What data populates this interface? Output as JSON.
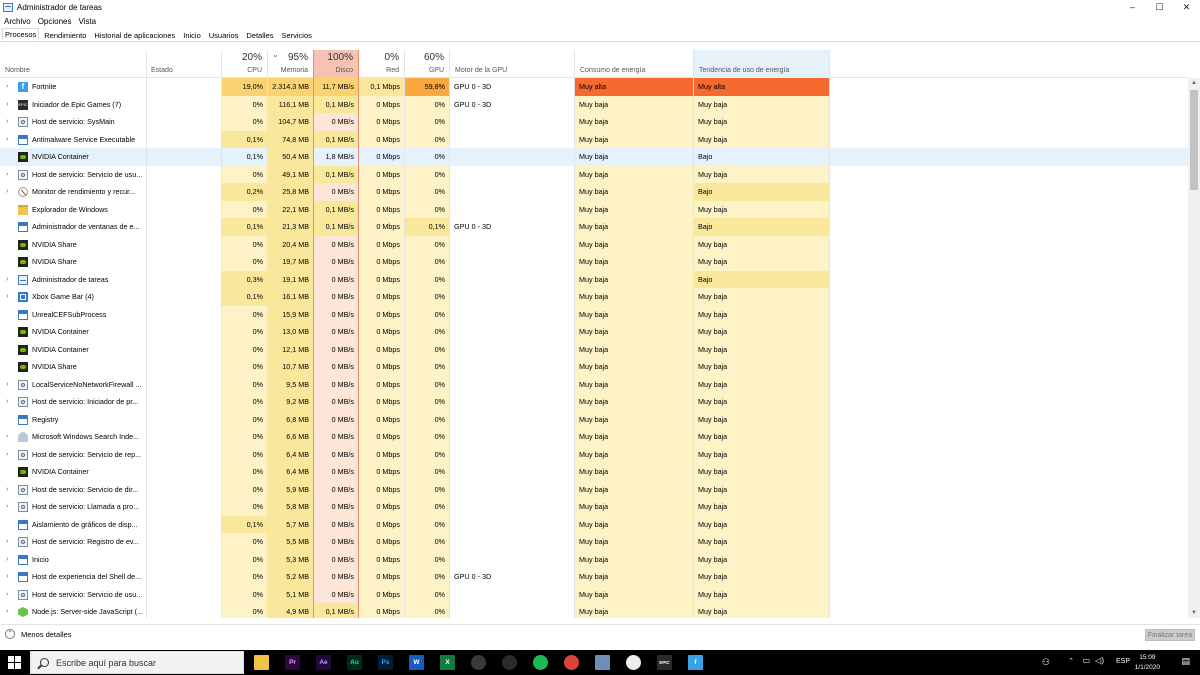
{
  "window": {
    "title": "Administrador de tareas",
    "controls": [
      "–",
      "☐",
      "✕"
    ]
  },
  "menu": [
    "Archivo",
    "Opciones",
    "Vista"
  ],
  "tabs": [
    "Procesos",
    "Rendimiento",
    "Historial de aplicaciones",
    "Inicio",
    "Usuarios",
    "Detalles",
    "Servicios"
  ],
  "header": {
    "name": "Nombre",
    "status": "Estado",
    "cpu": {
      "pct": "20%",
      "label": "CPU"
    },
    "memory": {
      "pct": "95%",
      "label": "Memoria"
    },
    "disk": {
      "pct": "100%",
      "label": "Disco"
    },
    "net": {
      "pct": "0%",
      "label": "Red"
    },
    "gpu": {
      "pct": "60%",
      "label": "GPU"
    },
    "gpu_engine": "Motor de la GPU",
    "power": "Consumo de energía",
    "power_trend": "Tendencia de uso de energía"
  },
  "colors": {
    "cell_light": "#fdf3c6",
    "cell_mid": "#f9e79b",
    "cell_high": "#fbd272",
    "cell_orange": "#f9a73f",
    "power_high": "#f76a2f",
    "selected": "#e5f1fb"
  },
  "processes": [
    {
      "name": "Fortnite",
      "icon": "fortnite-icon",
      "expand": true,
      "cpu": "19,0%",
      "mem": "2.314,3 MB",
      "disk": "11,7 MB/s",
      "net": "0,1 Mbps",
      "gpu": "59,8%",
      "engine": "GPU 0 - 3D",
      "power": "Muy alta",
      "trend": "Muy alta",
      "hot": true
    },
    {
      "name": "Iniciador de Epic Games (7)",
      "icon": "epic-games-icon",
      "expand": true,
      "cpu": "0%",
      "mem": "116,1 MB",
      "disk": "0,1 MB/s",
      "net": "0 Mbps",
      "gpu": "0%",
      "engine": "GPU 0 - 3D",
      "power": "Muy baja",
      "trend": "Muy baja"
    },
    {
      "name": "Host de servicio: SysMain",
      "icon": "gear-icon",
      "expand": true,
      "cpu": "0%",
      "mem": "104,7 MB",
      "disk": "0 MB/s",
      "net": "0 Mbps",
      "gpu": "0%",
      "engine": "",
      "power": "Muy baja",
      "trend": "Muy baja"
    },
    {
      "name": "Antimalware Service Executable",
      "icon": "window-icon",
      "expand": true,
      "cpu": "0,1%",
      "mem": "74,8 MB",
      "disk": "0,1 MB/s",
      "net": "0 Mbps",
      "gpu": "0%",
      "engine": "",
      "power": "Muy baja",
      "trend": "Muy baja"
    },
    {
      "name": "NVIDIA Container",
      "icon": "nvidia-icon",
      "expand": false,
      "cpu": "0,1%",
      "mem": "50,4 MB",
      "disk": "1,8 MB/s",
      "net": "0 Mbps",
      "gpu": "0%",
      "engine": "",
      "power": "Muy baja",
      "trend": "Bajo",
      "selected": true
    },
    {
      "name": "Host de servicio: Servicio de usu...",
      "icon": "gear-icon",
      "expand": true,
      "cpu": "0%",
      "mem": "49,1 MB",
      "disk": "0,1 MB/s",
      "net": "0 Mbps",
      "gpu": "0%",
      "engine": "",
      "power": "Muy baja",
      "trend": "Muy baja"
    },
    {
      "name": "Monitor de rendimiento y recur...",
      "icon": "monitor-icon",
      "expand": true,
      "cpu": "0,2%",
      "mem": "25,8 MB",
      "disk": "0 MB/s",
      "net": "0 Mbps",
      "gpu": "0%",
      "engine": "",
      "power": "Muy baja",
      "trend": "Bajo"
    },
    {
      "name": "Explorador de Windows",
      "icon": "folder-icon",
      "expand": false,
      "cpu": "0%",
      "mem": "22,1 MB",
      "disk": "0,1 MB/s",
      "net": "0 Mbps",
      "gpu": "0%",
      "engine": "",
      "power": "Muy baja",
      "trend": "Muy baja"
    },
    {
      "name": "Administrador de ventanas de e...",
      "icon": "window-icon",
      "expand": false,
      "cpu": "0,1%",
      "mem": "21,3 MB",
      "disk": "0,1 MB/s",
      "net": "0 Mbps",
      "gpu": "0,1%",
      "engine": "GPU 0 - 3D",
      "power": "Muy baja",
      "trend": "Bajo"
    },
    {
      "name": "NVIDIA Share",
      "icon": "nvidia-icon",
      "expand": false,
      "cpu": "0%",
      "mem": "20,4 MB",
      "disk": "0 MB/s",
      "net": "0 Mbps",
      "gpu": "0%",
      "engine": "",
      "power": "Muy baja",
      "trend": "Muy baja"
    },
    {
      "name": "NVIDIA Share",
      "icon": "nvidia-icon",
      "expand": false,
      "cpu": "0%",
      "mem": "19,7 MB",
      "disk": "0 MB/s",
      "net": "0 Mbps",
      "gpu": "0%",
      "engine": "",
      "power": "Muy baja",
      "trend": "Muy baja"
    },
    {
      "name": "Administrador de tareas",
      "icon": "taskmgr-icon",
      "expand": true,
      "cpu": "0,3%",
      "mem": "19,1 MB",
      "disk": "0 MB/s",
      "net": "0 Mbps",
      "gpu": "0%",
      "engine": "",
      "power": "Muy baja",
      "trend": "Bajo"
    },
    {
      "name": "Xbox Game Bar (4)",
      "icon": "xbox-icon",
      "expand": true,
      "cpu": "0,1%",
      "mem": "16,1 MB",
      "disk": "0 MB/s",
      "net": "0 Mbps",
      "gpu": "0%",
      "engine": "",
      "power": "Muy baja",
      "trend": "Muy baja"
    },
    {
      "name": "UnrealCEFSubProcess",
      "icon": "window-icon",
      "expand": false,
      "cpu": "0%",
      "mem": "15,9 MB",
      "disk": "0 MB/s",
      "net": "0 Mbps",
      "gpu": "0%",
      "engine": "",
      "power": "Muy baja",
      "trend": "Muy baja"
    },
    {
      "name": "NVIDIA Container",
      "icon": "nvidia-icon",
      "expand": false,
      "cpu": "0%",
      "mem": "13,0 MB",
      "disk": "0 MB/s",
      "net": "0 Mbps",
      "gpu": "0%",
      "engine": "",
      "power": "Muy baja",
      "trend": "Muy baja"
    },
    {
      "name": "NVIDIA Container",
      "icon": "nvidia-icon",
      "expand": false,
      "cpu": "0%",
      "mem": "12,1 MB",
      "disk": "0 MB/s",
      "net": "0 Mbps",
      "gpu": "0%",
      "engine": "",
      "power": "Muy baja",
      "trend": "Muy baja"
    },
    {
      "name": "NVIDIA Share",
      "icon": "nvidia-icon",
      "expand": false,
      "cpu": "0%",
      "mem": "10,7 MB",
      "disk": "0 MB/s",
      "net": "0 Mbps",
      "gpu": "0%",
      "engine": "",
      "power": "Muy baja",
      "trend": "Muy baja"
    },
    {
      "name": "LocalServiceNoNetworkFirewall ...",
      "icon": "gear-icon",
      "expand": true,
      "cpu": "0%",
      "mem": "9,5 MB",
      "disk": "0 MB/s",
      "net": "0 Mbps",
      "gpu": "0%",
      "engine": "",
      "power": "Muy baja",
      "trend": "Muy baja"
    },
    {
      "name": "Host de servicio: Iniciador de pr...",
      "icon": "gear-icon",
      "expand": true,
      "cpu": "0%",
      "mem": "9,2 MB",
      "disk": "0 MB/s",
      "net": "0 Mbps",
      "gpu": "0%",
      "engine": "",
      "power": "Muy baja",
      "trend": "Muy baja"
    },
    {
      "name": "Registry",
      "icon": "window-icon",
      "expand": false,
      "cpu": "0%",
      "mem": "6,8 MB",
      "disk": "0 MB/s",
      "net": "0 Mbps",
      "gpu": "0%",
      "engine": "",
      "power": "Muy baja",
      "trend": "Muy baja"
    },
    {
      "name": "Microsoft Windows Search Inde...",
      "icon": "search-user-icon",
      "expand": true,
      "cpu": "0%",
      "mem": "6,6 MB",
      "disk": "0 MB/s",
      "net": "0 Mbps",
      "gpu": "0%",
      "engine": "",
      "power": "Muy baja",
      "trend": "Muy baja"
    },
    {
      "name": "Host de servicio: Servicio de rep...",
      "icon": "gear-icon",
      "expand": true,
      "cpu": "0%",
      "mem": "6,4 MB",
      "disk": "0 MB/s",
      "net": "0 Mbps",
      "gpu": "0%",
      "engine": "",
      "power": "Muy baja",
      "trend": "Muy baja"
    },
    {
      "name": "NVIDIA Container",
      "icon": "nvidia-icon",
      "expand": false,
      "cpu": "0%",
      "mem": "6,4 MB",
      "disk": "0 MB/s",
      "net": "0 Mbps",
      "gpu": "0%",
      "engine": "",
      "power": "Muy baja",
      "trend": "Muy baja"
    },
    {
      "name": "Host de servicio: Servicio de dir...",
      "icon": "gear-icon",
      "expand": true,
      "cpu": "0%",
      "mem": "5,9 MB",
      "disk": "0 MB/s",
      "net": "0 Mbps",
      "gpu": "0%",
      "engine": "",
      "power": "Muy baja",
      "trend": "Muy baja"
    },
    {
      "name": "Host de servicio: Llamada a pro...",
      "icon": "gear-icon",
      "expand": true,
      "cpu": "0%",
      "mem": "5,8 MB",
      "disk": "0 MB/s",
      "net": "0 Mbps",
      "gpu": "0%",
      "engine": "",
      "power": "Muy baja",
      "trend": "Muy baja"
    },
    {
      "name": "Aislamiento de gráficos de disp...",
      "icon": "window-icon",
      "expand": false,
      "cpu": "0,1%",
      "mem": "5,7 MB",
      "disk": "0 MB/s",
      "net": "0 Mbps",
      "gpu": "0%",
      "engine": "",
      "power": "Muy baja",
      "trend": "Muy baja"
    },
    {
      "name": "Host de servicio: Registro de ev...",
      "icon": "gear-icon",
      "expand": true,
      "cpu": "0%",
      "mem": "5,5 MB",
      "disk": "0 MB/s",
      "net": "0 Mbps",
      "gpu": "0%",
      "engine": "",
      "power": "Muy baja",
      "trend": "Muy baja"
    },
    {
      "name": "Inicio",
      "icon": "window-icon",
      "expand": true,
      "cpu": "0%",
      "mem": "5,3 MB",
      "disk": "0 MB/s",
      "net": "0 Mbps",
      "gpu": "0%",
      "engine": "",
      "power": "Muy baja",
      "trend": "Muy baja"
    },
    {
      "name": "Host de experiencia del Shell de...",
      "icon": "window-icon",
      "expand": true,
      "cpu": "0%",
      "mem": "5,2 MB",
      "disk": "0 MB/s",
      "net": "0 Mbps",
      "gpu": "0%",
      "engine": "GPU 0 - 3D",
      "power": "Muy baja",
      "trend": "Muy baja"
    },
    {
      "name": "Host de servicio: Servicio de usu...",
      "icon": "gear-icon",
      "expand": true,
      "cpu": "0%",
      "mem": "5,1 MB",
      "disk": "0 MB/s",
      "net": "0 Mbps",
      "gpu": "0%",
      "engine": "",
      "power": "Muy baja",
      "trend": "Muy baja"
    },
    {
      "name": "Node.js: Server-side JavaScript (...",
      "icon": "nodejs-icon",
      "expand": true,
      "cpu": "0%",
      "mem": "4,9 MB",
      "disk": "0,1 MB/s",
      "net": "0 Mbps",
      "gpu": "0%",
      "engine": "",
      "power": "Muy baja",
      "trend": "Muy baja"
    }
  ],
  "footer": {
    "less_details": "Menos detalles",
    "end_task": "Finalizar tarea"
  },
  "taskbar": {
    "search_placeholder": "Escribe aquí para buscar",
    "apps": [
      {
        "name": "file-explorer-icon",
        "label": "",
        "bg": "#f0c24b",
        "fg": "#7a5a00"
      },
      {
        "name": "premiere-icon",
        "label": "Pr",
        "bg": "#2a0a3c",
        "fg": "#e39cff"
      },
      {
        "name": "after-effects-icon",
        "label": "Ae",
        "bg": "#1f0a3a",
        "fg": "#c59cff"
      },
      {
        "name": "audition-icon",
        "label": "Au",
        "bg": "#002a1e",
        "fg": "#00e4bb"
      },
      {
        "name": "photoshop-icon",
        "label": "Ps",
        "bg": "#001d34",
        "fg": "#31a8ff"
      },
      {
        "name": "word-icon",
        "label": "W",
        "bg": "#185abd",
        "fg": "#ffffff"
      },
      {
        "name": "excel-icon",
        "label": "X",
        "bg": "#107c41",
        "fg": "#ffffff"
      },
      {
        "name": "davinci-icon",
        "label": "",
        "bg": "#3a3a3a",
        "fg": "#ffffff"
      },
      {
        "name": "obs-icon",
        "label": "",
        "bg": "#2b2b2b",
        "fg": "#ffffff"
      },
      {
        "name": "spotify-icon",
        "label": "",
        "bg": "#1db954",
        "fg": "#000000"
      },
      {
        "name": "chrome-icon",
        "label": "",
        "bg": "#db4437",
        "fg": "#ffffff"
      },
      {
        "name": "taskmgr-taskbar-icon",
        "label": "",
        "bg": "#6d8fb5",
        "fg": "#ffffff"
      },
      {
        "name": "perfmon-taskbar-icon",
        "label": "",
        "bg": "#eeeeee",
        "fg": "#c0392b"
      },
      {
        "name": "epic-taskbar-icon",
        "label": "EPIC",
        "bg": "#2a2a2a",
        "fg": "#ffffff"
      },
      {
        "name": "fortnite-taskbar-icon",
        "label": "f",
        "bg": "#3aa0e8",
        "fg": "#ffffff"
      }
    ],
    "language": "ESP",
    "time": "15:09",
    "date": "1/1/2020"
  }
}
